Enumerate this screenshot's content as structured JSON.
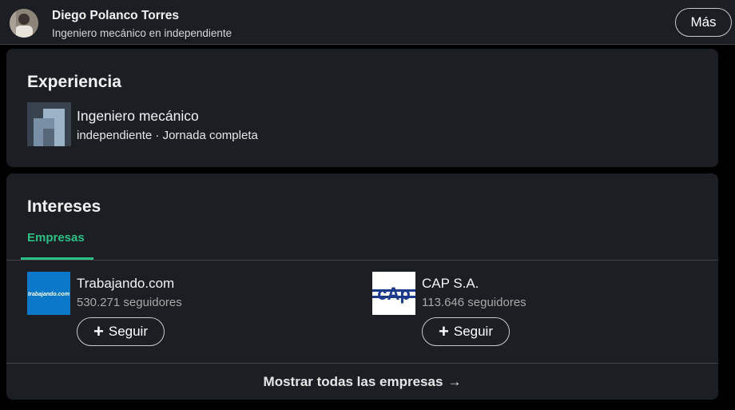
{
  "header": {
    "name": "Diego Polanco Torres",
    "headline": "Ingeniero mecánico en independiente",
    "more_button": "Más"
  },
  "experience": {
    "title": "Experiencia",
    "items": [
      {
        "role": "Ingeniero mecánico",
        "subtitle": "independiente · Jornada completa"
      }
    ]
  },
  "interests": {
    "title": "Intereses",
    "tab": "Empresas",
    "companies": [
      {
        "name": "Trabajando.com",
        "followers": "530.271 seguidores",
        "follow_label": "Seguir",
        "logo_text": "trabajando.com",
        "logo_color": "#0a78c8"
      },
      {
        "name": "CAP S.A.",
        "followers": "113.646 seguidores",
        "follow_label": "Seguir",
        "logo_text": "cAp",
        "logo_color": "#1c3a8c"
      }
    ],
    "show_all": "Mostrar todas las empresas",
    "show_all_arrow": "→"
  },
  "colors": {
    "accent": "#2fbf86",
    "card_bg": "#1b1f23",
    "page_bg": "#000000"
  }
}
